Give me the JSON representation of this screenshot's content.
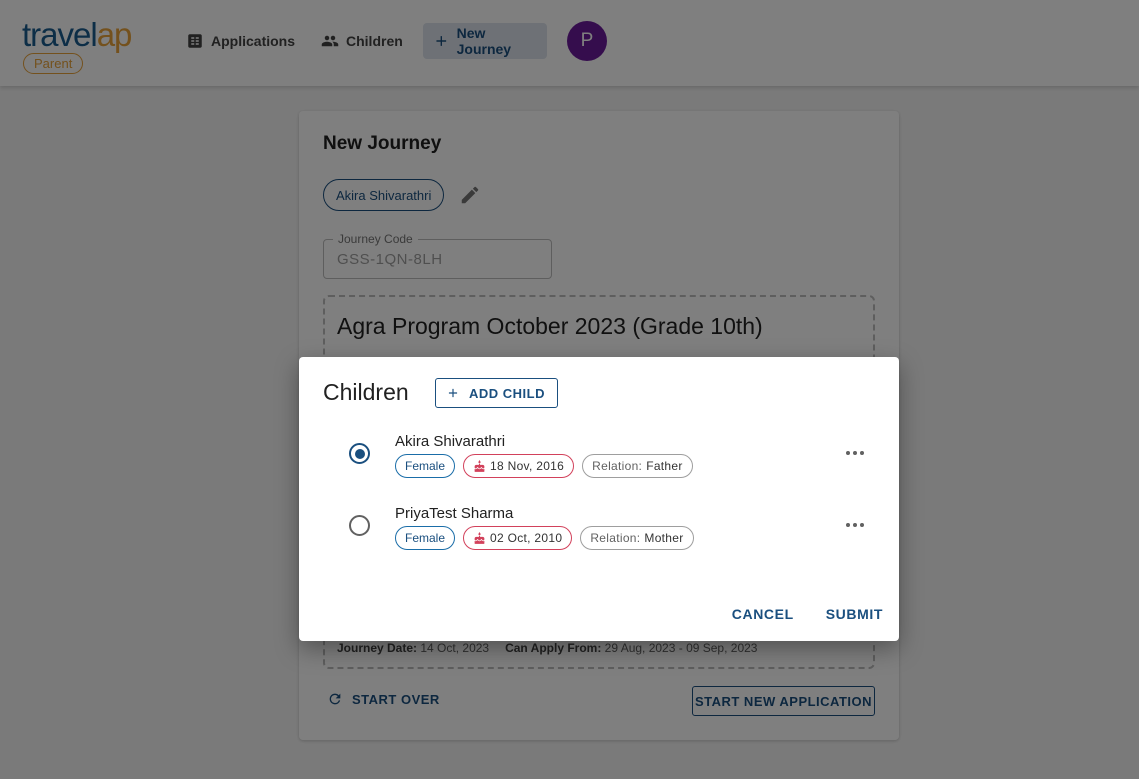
{
  "header": {
    "logo_travel": "travel",
    "logo_ap": "ap",
    "logo_badge": "Parent",
    "nav": {
      "applications": "Applications",
      "children": "Children",
      "new_journey": "New Journey"
    },
    "avatar_initial": "P",
    "colors": {
      "brand": "#1a5d8f",
      "accent": "#e8a23a",
      "avatar": "#6a1b9a"
    }
  },
  "card": {
    "title": "New Journey",
    "selected_child_chip": "Akira Shivarathri",
    "journey_code": {
      "label": "Journey Code",
      "value": "GSS-1QN-8LH"
    },
    "program_title": "Agra Program October 2023 (Grade 10th)",
    "meta": {
      "journey_date_label": "Journey Date:",
      "journey_date": "14 Oct, 2023",
      "apply_label": "Can Apply From:",
      "apply_range": "29 Aug, 2023 - 09 Sep, 2023"
    },
    "start_over": "START OVER",
    "start_new": "START NEW APPLICATION"
  },
  "dialog": {
    "title": "Children",
    "add_child": "ADD CHILD",
    "children": [
      {
        "name": "Akira Shivarathri",
        "gender": "Female",
        "dob": "18 Nov, 2016",
        "relation_label": "Relation:",
        "relation": "Father",
        "selected": true
      },
      {
        "name": "PriyaTest Sharma",
        "gender": "Female",
        "dob": "02 Oct, 2010",
        "relation_label": "Relation:",
        "relation": "Mother",
        "selected": false
      }
    ],
    "cancel": "CANCEL",
    "submit": "SUBMIT"
  }
}
